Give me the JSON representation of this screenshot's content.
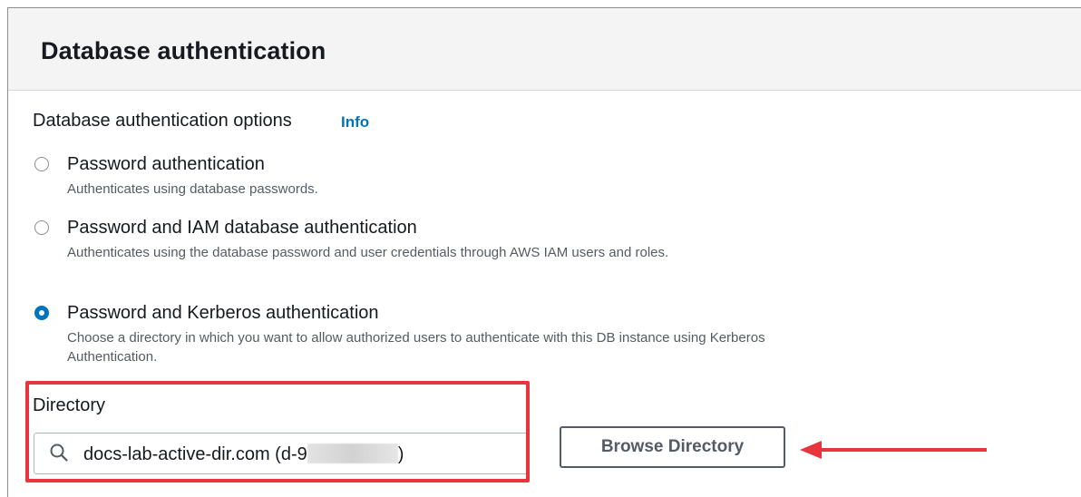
{
  "section": {
    "title": "Database authentication"
  },
  "auth_options": {
    "label": "Database authentication options",
    "info_link": "Info",
    "options": [
      {
        "label": "Password authentication",
        "description": "Authenticates using database passwords.",
        "selected": false
      },
      {
        "label": "Password and IAM database authentication",
        "description": "Authenticates using the database password and user credentials through AWS IAM users and roles.",
        "selected": false
      },
      {
        "label": "Password and Kerberos authentication",
        "description": "Choose a directory in which you want to allow authorized users to authenticate with this DB instance using Kerberos Authentication.",
        "selected": true
      }
    ]
  },
  "directory": {
    "label": "Directory",
    "value_prefix": "docs-lab-active-dir.com (d-9",
    "value_suffix": ")",
    "browse_button": "Browse Directory"
  },
  "colors": {
    "accent": "#0073bb",
    "highlight": "#e8353d"
  }
}
